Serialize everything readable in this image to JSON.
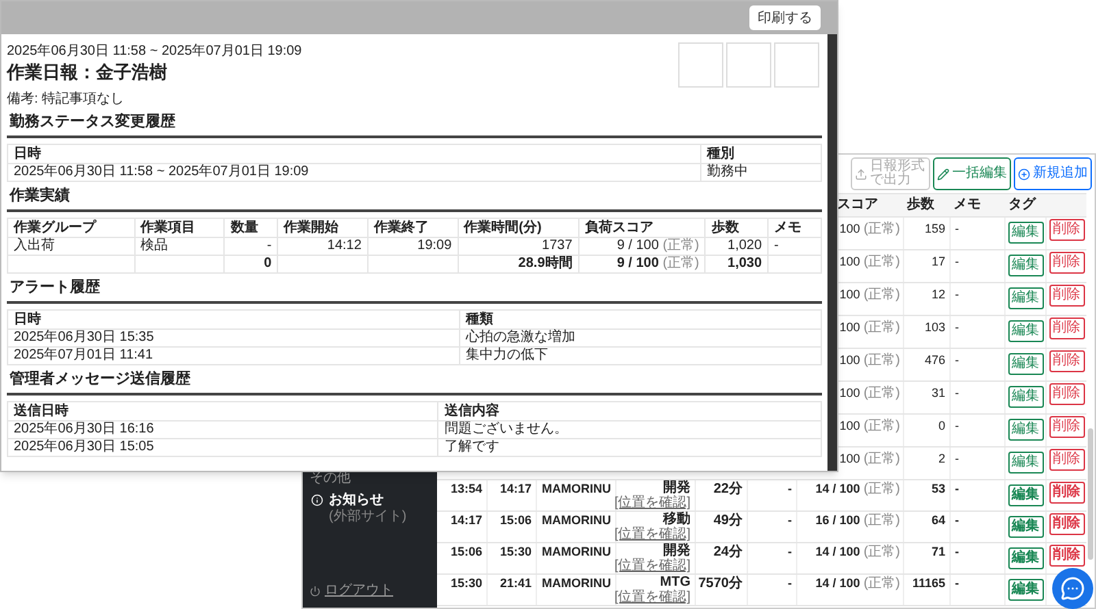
{
  "print_preview": {
    "print_button": "印刷する",
    "period": "2025年06月30日 11:58 ~ 2025年07月01日 19:09",
    "title": "作業日報：金子浩樹",
    "note": "備考: 特記事項なし",
    "photo_slots": [
      {
        "kind": "empty"
      },
      {
        "kind": "empty"
      },
      {
        "kind": "empty"
      }
    ],
    "sections": [
      {
        "heading": "勤務ステータス変更履歴",
        "kind": "simple",
        "columns": [
          "日時",
          "種別"
        ],
        "rows": [
          {
            "kind": "entry",
            "cells": [
              "2025年06月30日 11:58 ~ 2025年07月01日 19:09",
              "勤務中"
            ]
          }
        ]
      },
      {
        "heading": "作業実績",
        "kind": "results",
        "columns": [
          "作業グループ",
          "作業項目",
          "数量",
          "作業開始",
          "作業終了",
          "作業時間(分)",
          "負荷スコア",
          "歩数",
          "メモ"
        ],
        "rows": [
          {
            "kind": "entry",
            "cells": [
              "入出荷",
              "検品",
              "-",
              "14:12",
              "19:09",
              "1737",
              {
                "value": "9 / 100",
                "note": "(正常)"
              },
              "1,020",
              "-"
            ]
          },
          {
            "kind": "total",
            "cells": [
              "",
              "",
              "0",
              "",
              "",
              "28.9時間",
              {
                "value": "9 / 100",
                "note": "(正常)"
              },
              "1,030",
              ""
            ]
          }
        ]
      },
      {
        "heading": "アラート履歴",
        "kind": "simple",
        "columns": [
          "日時",
          "種類"
        ],
        "rows": [
          {
            "kind": "entry",
            "cells": [
              "2025年06月30日 15:35",
              "心拍の急激な増加"
            ]
          },
          {
            "kind": "entry",
            "cells": [
              "2025年07月01日 11:41",
              "集中力の低下"
            ]
          }
        ]
      },
      {
        "heading": "管理者メッセージ送信履歴",
        "kind": "simple",
        "columns": [
          "送信日時",
          "送信内容"
        ],
        "rows": [
          {
            "kind": "entry",
            "cells": [
              "2025年06月30日 16:16",
              "問題ございません。"
            ]
          },
          {
            "kind": "entry",
            "cells": [
              "2025年06月30日 15:05",
              "了解です"
            ]
          }
        ]
      }
    ]
  },
  "app": {
    "toolbar": [
      {
        "label": "日報形式で出力",
        "kind": "export",
        "disabled": true
      },
      {
        "label": "一括編集",
        "kind": "bulk_edit",
        "disabled": false
      },
      {
        "label": "新規追加",
        "kind": "add",
        "disabled": false
      }
    ],
    "table": {
      "visible_columns": [
        "スコア",
        "歩数",
        "メモ",
        "タグ"
      ],
      "upper_rows": [
        {
          "score": "100",
          "status": "(正常)",
          "steps": "159",
          "memo": "-",
          "edit": "編集",
          "delete": "削除"
        },
        {
          "score": "100",
          "status": "(正常)",
          "steps": "17",
          "memo": "-",
          "edit": "編集",
          "delete": "削除"
        },
        {
          "score": "100",
          "status": "(正常)",
          "steps": "12",
          "memo": "-",
          "edit": "編集",
          "delete": "削除"
        },
        {
          "score": "100",
          "status": "(正常)",
          "steps": "103",
          "memo": "-",
          "edit": "編集",
          "delete": "削除"
        },
        {
          "score": "100",
          "status": "(正常)",
          "steps": "476",
          "memo": "-",
          "edit": "編集",
          "delete": "削除"
        },
        {
          "score": "100",
          "status": "(正常)",
          "steps": "31",
          "memo": "-",
          "edit": "編集",
          "delete": "削除"
        },
        {
          "score": "100",
          "status": "(正常)",
          "steps": "0",
          "memo": "-",
          "edit": "編集",
          "delete": "削除"
        },
        {
          "score": "100",
          "status": "(正常)",
          "steps": "2",
          "memo": "-",
          "edit": "編集",
          "delete": "削除"
        }
      ],
      "rows": [
        {
          "start": "13:54",
          "end": "14:17",
          "device": "MAMORINU",
          "task": "開発",
          "location_link": "[位置を確認]",
          "duration": "22分",
          "column_6": "-",
          "score": "14 / 100",
          "status": "(正常)",
          "steps": "53",
          "memo": "-",
          "edit": "編集",
          "delete": "削除"
        },
        {
          "start": "14:17",
          "end": "15:06",
          "device": "MAMORINU",
          "task": "移動",
          "location_link": "[位置を確認]",
          "duration": "49分",
          "column_6": "-",
          "score": "16 / 100",
          "status": "(正常)",
          "steps": "64",
          "memo": "-",
          "edit": "編集",
          "delete": "削除"
        },
        {
          "start": "15:06",
          "end": "15:30",
          "device": "MAMORINU",
          "task": "開発",
          "location_link": "[位置を確認]",
          "duration": "24分",
          "column_6": "-",
          "score": "14 / 100",
          "status": "(正常)",
          "steps": "71",
          "memo": "-",
          "edit": "編集",
          "delete": "削除"
        },
        {
          "start": "15:30",
          "end": "21:41",
          "device": "MAMORINU",
          "task": "MTG",
          "location_link": "[位置を確認]",
          "duration": "7570分",
          "column_6": "-",
          "score": "14 / 100",
          "status": "(正常)",
          "steps": "11165",
          "memo": "-",
          "edit": "編集"
        }
      ]
    },
    "sidebar": {
      "section": "その他",
      "items": [
        {
          "kind": "info",
          "label": "お知らせ",
          "note": "(外部サイト)"
        }
      ],
      "logout": "ログアウト"
    }
  }
}
